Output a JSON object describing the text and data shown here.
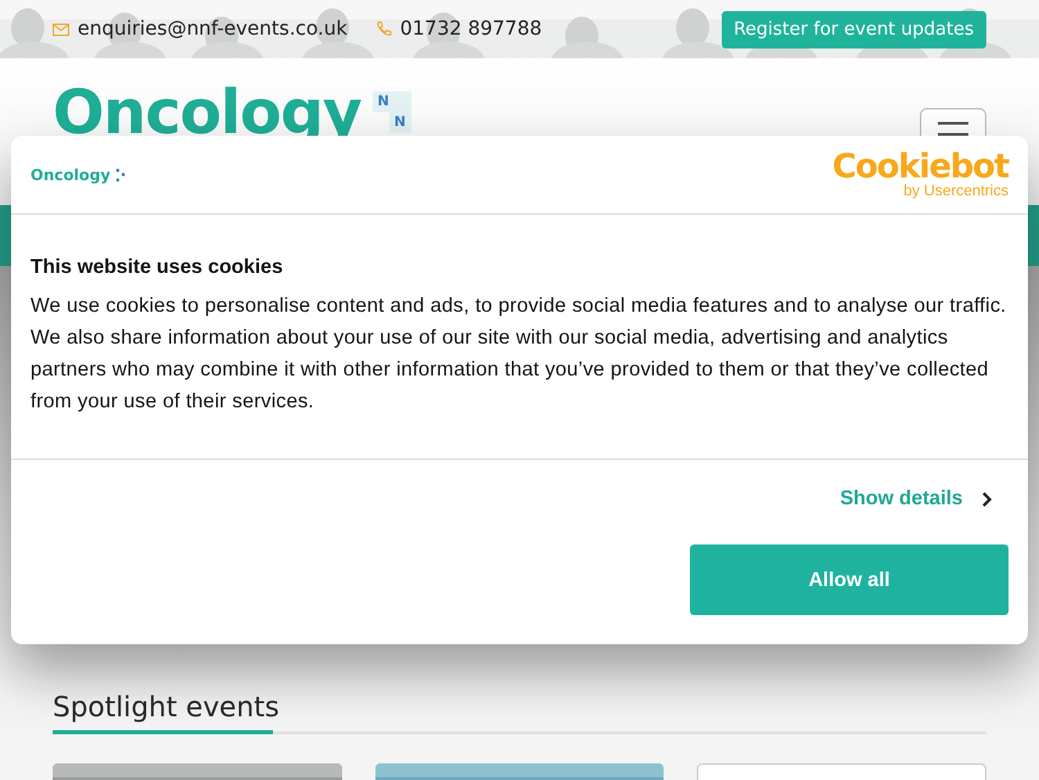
{
  "top_bar": {
    "email": "enquiries@nnf-events.co.uk",
    "phone": "01732 897788",
    "register_button": "Register for event updates"
  },
  "header": {
    "logo": "Oncology",
    "logo_marks": [
      "N",
      "N"
    ]
  },
  "cookie_dialog": {
    "logo": "Oncology",
    "brand": "Cookiebot",
    "brand_sub": "by Usercentrics",
    "title": "This website uses cookies",
    "body": "We use cookies to personalise content and ads, to provide social media features and to analyse our traffic. We also share information about your use of our site with our social media, advertising and analytics partners who may combine it with other information that you’ve provided to them or that they’ve collected from your use of their services.",
    "details_link": "Show details",
    "allow_button": "Allow all"
  },
  "spotlight": {
    "heading": "Spotlight events",
    "cards": [
      {
        "kind": "picture"
      },
      {
        "kind": "picture"
      },
      {
        "kind": "blank"
      }
    ]
  }
}
